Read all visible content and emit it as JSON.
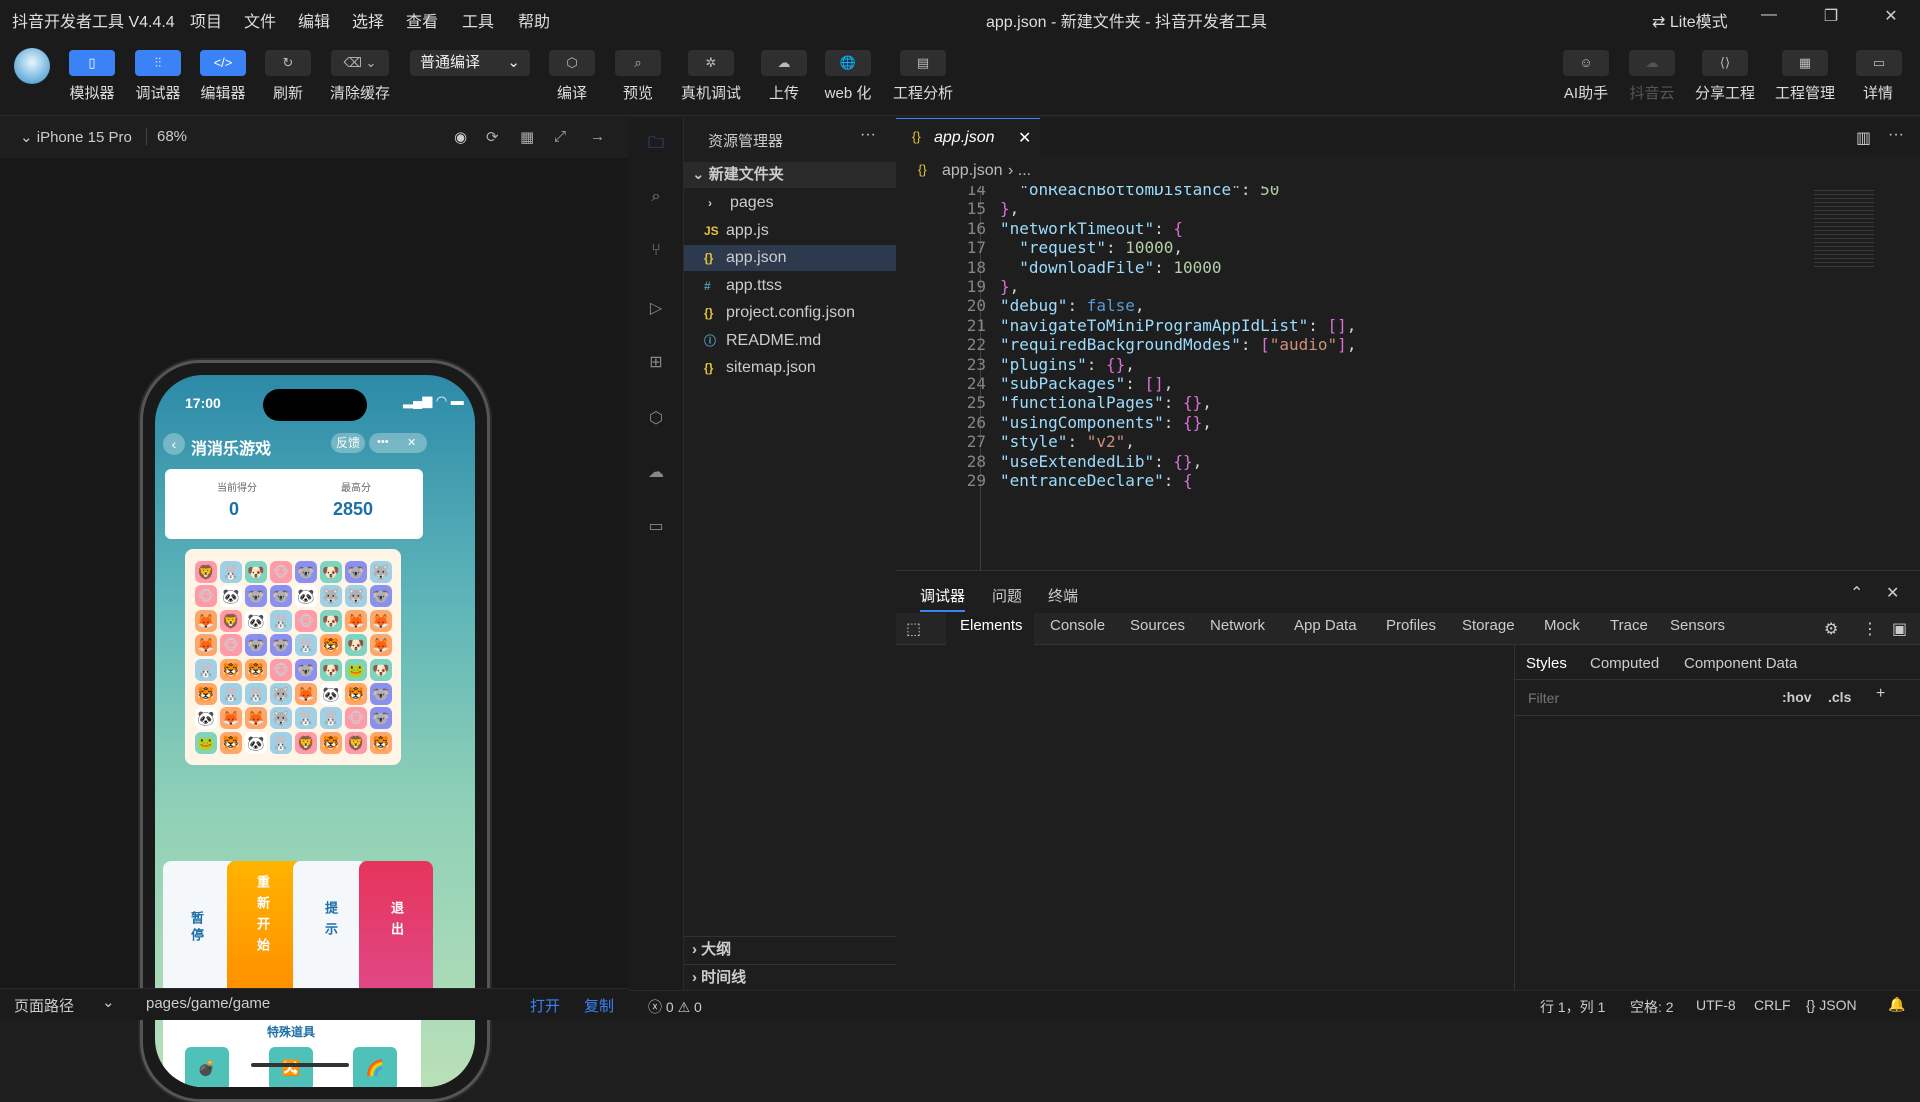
{
  "app": {
    "title": "抖音开发者工具 V4.4.4",
    "window_title": "app.json - 新建文件夹 - 抖音开发者工具",
    "lite_mode": "Lite模式"
  },
  "menu": [
    "项目",
    "文件",
    "编辑",
    "选择",
    "查看",
    "工具",
    "帮助"
  ],
  "toolbar": {
    "left": [
      "模拟器",
      "调试器",
      "编辑器",
      "刷新",
      "清除缓存"
    ],
    "compile_mode": "普通编译",
    "center": [
      "编译",
      "预览",
      "真机调试",
      "上传",
      "web 化",
      "工程分析"
    ],
    "right": [
      "AI助手",
      "抖音云",
      "分享工程",
      "工程管理",
      "详情"
    ]
  },
  "simulator": {
    "device": "iPhone 15 Pro",
    "zoom": "68%",
    "path_label": "页面路径",
    "path": "pages/game/game",
    "open": "打开",
    "copy": "复制",
    "phone": {
      "time": "17:00",
      "page_title": "消消乐游戏",
      "feedback": "反馈",
      "more": "•••",
      "close": "✕",
      "score_label": "当前得分",
      "score": "0",
      "best_label": "最高分",
      "best": "2850",
      "board": [
        [
          "🦁",
          "🐰",
          "🐶",
          "🐵",
          "🐨",
          "🐶",
          "🐨",
          "🐺"
        ],
        [
          "🐵",
          "🐼",
          "🐨",
          "🐨",
          "🐼",
          "🐺",
          "🐺",
          "🐨"
        ],
        [
          "🦊",
          "🦁",
          "🐼",
          "🐰",
          "🐵",
          "🐶",
          "🦊",
          "🦊"
        ],
        [
          "🦊",
          "🐵",
          "🐨",
          "🐨",
          "🐰",
          "🐯",
          "🐶",
          "🦊"
        ],
        [
          "🐰",
          "🐯",
          "🐯",
          "🐵",
          "🐨",
          "🐶",
          "🐸",
          "🐶"
        ],
        [
          "🐯",
          "🐰",
          "🐰",
          "🐺",
          "🦊",
          "🐼",
          "🐯",
          "🐨"
        ],
        [
          "🐼",
          "🦊",
          "🦊",
          "🐺",
          "🐰",
          "🐰",
          "🐵",
          "🐨"
        ],
        [
          "🐸",
          "🐯",
          "🐼",
          "🐰",
          "🦁",
          "🐯",
          "🦁",
          "🐯"
        ]
      ],
      "buttons": [
        {
          "label": "暂停",
          "icon": "⏸"
        },
        {
          "label": "重新开始",
          "icon": "🔄"
        },
        {
          "label": "提示",
          "icon": "💡"
        },
        {
          "label": "退出",
          "icon": "🏠"
        }
      ],
      "props_title": "特殊道具",
      "props": [
        "💣",
        "🔀",
        "🌈"
      ]
    }
  },
  "explorer": {
    "title": "资源管理器",
    "folder": "新建文件夹",
    "files": [
      {
        "name": "pages",
        "icon": "›",
        "color": "#ccc"
      },
      {
        "name": "app.js",
        "icon": "JS",
        "color": "#e8c23a"
      },
      {
        "name": "app.json",
        "icon": "{}",
        "color": "#e8c23a"
      },
      {
        "name": "app.ttss",
        "icon": "#",
        "color": "#519aba"
      },
      {
        "name": "project.config.json",
        "icon": "{}",
        "color": "#e8c23a"
      },
      {
        "name": "README.md",
        "icon": "ⓘ",
        "color": "#519aba"
      },
      {
        "name": "sitemap.json",
        "icon": "{}",
        "color": "#e8c23a"
      }
    ],
    "outline": "大纲",
    "timeline": "时间线"
  },
  "editor": {
    "tab": "app.json",
    "breadcrumb": "app.json",
    "lines": [
      {
        "n": "14",
        "html": "  <span class='k'>\"onReachBottomDistance\"</span>: <span class='n'>50</span>"
      },
      {
        "n": "15",
        "html": "<span class='p'>}</span>,"
      },
      {
        "n": "16",
        "html": "<span class='k'>\"networkTimeout\"</span>: <span class='p'>{</span>"
      },
      {
        "n": "17",
        "html": "  <span class='k'>\"request\"</span>: <span class='n'>10000</span>,"
      },
      {
        "n": "18",
        "html": "  <span class='k'>\"downloadFile\"</span>: <span class='n'>10000</span>"
      },
      {
        "n": "19",
        "html": "<span class='p'>}</span>,"
      },
      {
        "n": "20",
        "html": "<span class='k'>\"debug\"</span>: <span class='b'>false</span>,"
      },
      {
        "n": "21",
        "html": "<span class='k'>\"navigateToMiniProgramAppIdList\"</span>: <span class='p'>[]</span>,"
      },
      {
        "n": "22",
        "html": "<span class='k'>\"requiredBackgroundModes\"</span>: <span class='p'>[</span><span class='s'>\"audio\"</span><span class='p'>]</span>,"
      },
      {
        "n": "23",
        "html": "<span class='k'>\"plugins\"</span>: <span class='p'>{}</span>,"
      },
      {
        "n": "24",
        "html": "<span class='k'>\"subPackages\"</span>: <span class='p'>[]</span>,"
      },
      {
        "n": "25",
        "html": "<span class='k'>\"functionalPages\"</span>: <span class='p'>{}</span>,"
      },
      {
        "n": "26",
        "html": "<span class='k'>\"usingComponents\"</span>: <span class='p'>{}</span>,"
      },
      {
        "n": "27",
        "html": "<span class='k'>\"style\"</span>: <span class='s'>\"v2\"</span>,"
      },
      {
        "n": "28",
        "html": "<span class='k'>\"useExtendedLib\"</span>: <span class='p'>{}</span>,"
      },
      {
        "n": "29",
        "html": "<span class='k'>\"entranceDeclare\"</span>: <span class='p'>{</span>"
      }
    ]
  },
  "devtools": {
    "panels": [
      "调试器",
      "问题",
      "终端"
    ],
    "tabs": [
      "Elements",
      "Console",
      "Sources",
      "Network",
      "App Data",
      "Profiles",
      "Storage",
      "Mock",
      "Trace",
      "Sensors"
    ],
    "side_tabs": [
      "Styles",
      "Computed",
      "Component Data"
    ],
    "filter_placeholder": "Filter",
    "hov": ":hov",
    "cls": ".cls"
  },
  "status": {
    "errors": "0",
    "warnings": "0",
    "position": "行 1，列 1",
    "spaces": "空格: 2",
    "encoding": "UTF-8",
    "eol": "CRLF",
    "lang": "JSON"
  }
}
